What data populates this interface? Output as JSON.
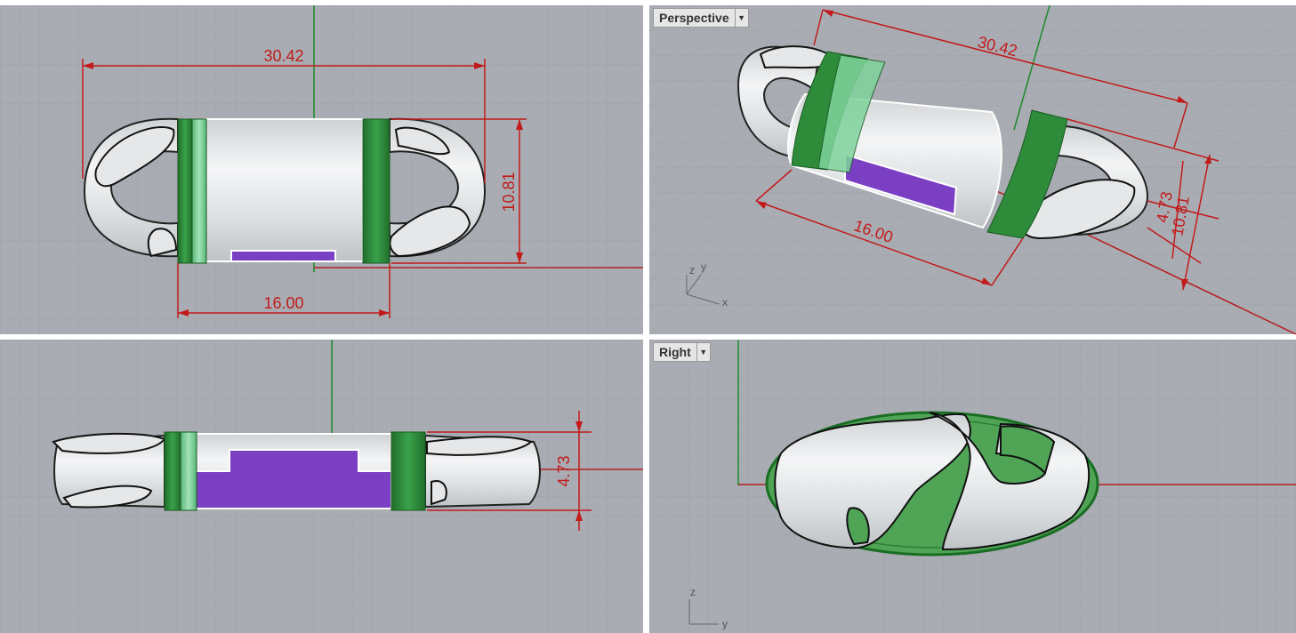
{
  "colors": {
    "background": "#a9adb3",
    "grid_minor": "#9ea2a8",
    "grid_major": "#8d9197",
    "axis_x": "#b52020",
    "axis_y": "#1d8a2b",
    "dimension": "#c21a1a",
    "band_green": "#2e8b3a",
    "band_light_green": "#7fd39c",
    "purple": "#7b3fc4",
    "body_silver": "#e8eaeb"
  },
  "viewports": {
    "top": {
      "dimensions": {
        "overall_length": "30.42",
        "height": "10.81",
        "band_width": "16.00"
      }
    },
    "perspective": {
      "title": "Perspective",
      "dimensions": {
        "overall_length": "30.42",
        "band_width": "16.00",
        "height_a": "4.73",
        "height_b": "10.81"
      },
      "axes": {
        "x": "x",
        "y": "y",
        "z": "z"
      }
    },
    "front": {
      "dimensions": {
        "thickness": "4.73"
      }
    },
    "right": {
      "title": "Right",
      "axes": {
        "z": "z",
        "y": "y"
      }
    }
  }
}
